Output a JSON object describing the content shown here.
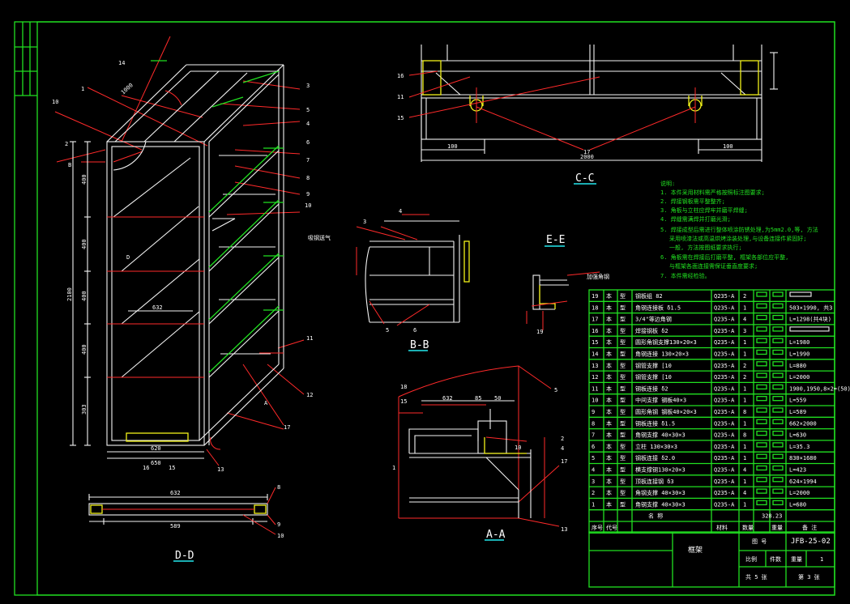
{
  "drawing": {
    "title": "框架",
    "drawing_no": "JFB-25-02",
    "scale": "1",
    "sheet_total": "共 5 张",
    "sheet_no": "第 3 张",
    "title_block_labels": {
      "drawing_no_label": "图 号",
      "scale_label": "比例",
      "qty_label": "件数",
      "weight_label": "重量"
    },
    "bom_footer": {
      "weight_val": "328.23",
      "labels": [
        "序号",
        "代号",
        "名 称",
        "数量",
        "材料",
        "重量",
        "备 注"
      ]
    }
  },
  "views": {
    "cc": "C-C",
    "bb": "B-B",
    "ee": "E-E",
    "aa": "A-A",
    "dd": "D-D"
  },
  "annotations": {
    "airflow": "吸钢送气",
    "gusset": "加强角钢"
  },
  "notes": {
    "heading": "说明:",
    "lines": [
      "1. 本件采用材料需严格按照标注图要求;",
      "2. 焊接钢板需平整整齐;",
      "3. 角板与立柱应焊牢并磨平焊缝;",
      "4. 焊缝需满焊并打磨光滑;",
      "5. 焊接成型后需进行整体喷涂防锈处理,为5mm2.0,等, 方法",
      "采用喷漆法或高温烘烤涂装处理,与设备连接件紧固好;",
      "一般, 方法按图纸要求执行;",
      "6. 角板需在焊接后打磨平整, 框架各部位应平整, ",
      "与框架各面连接需保证垂直度要求;",
      "7. 本件需经检验。"
    ]
  },
  "dimensions": {
    "iso_top_depth": "1000",
    "iso_height": "2100",
    "iso_seg": [
      "400",
      "400",
      "400",
      "400",
      "303"
    ],
    "iso_bottom_w1": "620",
    "iso_bottom_w2": "650",
    "iso_shelf": "632",
    "cc_total": "2000",
    "cc_left": "100",
    "cc_right": "100",
    "dd_top": "632",
    "dd_bottom": "589",
    "aa_top": "632",
    "aa_a": "85",
    "aa_b": "50",
    "aa_c": "10"
  },
  "callouts": {
    "iso": [
      "14",
      "10",
      "1",
      "2",
      "3",
      "5",
      "7",
      "8",
      "9",
      "10",
      "11",
      "12",
      "13",
      "16",
      "15",
      "17",
      "4",
      "6",
      "A",
      "D",
      "B"
    ],
    "cc": [
      "16",
      "11",
      "15",
      "17"
    ],
    "bb": [
      "3",
      "4",
      "5",
      "6",
      "19"
    ],
    "aa": [
      "18",
      "15",
      "2",
      "17",
      "4",
      "1",
      "5",
      "13"
    ],
    "dd": [
      "8",
      "9",
      "10"
    ]
  },
  "bom_rows": [
    {
      "no": "19",
      "code": "本",
      "cat": "型",
      "name": "钢板组 82",
      "mat": "Q235-A",
      "qty": "2",
      "spec": "",
      "note": "",
      "bar": true
    },
    {
      "no": "18",
      "code": "本",
      "cat": "型",
      "name": "角钢连接板 δ1.5",
      "mat": "Q235-A",
      "qty": "1",
      "spec": "",
      "note": "503×1990, 共3",
      "bar": false
    },
    {
      "no": "17",
      "code": "本",
      "cat": "型",
      "name": "3/4\"等边角钢",
      "mat": "Q235-A",
      "qty": "4",
      "spec": "",
      "note": "L=1298(共4块)",
      "bar": false
    },
    {
      "no": "16",
      "code": "本",
      "cat": "型",
      "name": "焊接钢板 δ2",
      "mat": "Q235-A",
      "qty": "3",
      "spec": "",
      "note": "",
      "bar": true
    },
    {
      "no": "15",
      "code": "本",
      "cat": "型",
      "name": "圆形角钢支撑130×20×3",
      "mat": "Q235-A",
      "qty": "1",
      "spec": "",
      "note": "L=1980",
      "bar": false
    },
    {
      "no": "14",
      "code": "本",
      "cat": "型",
      "name": "角钢连接 130×20×3",
      "mat": "Q235-A",
      "qty": "1",
      "spec": "",
      "note": "L=1990",
      "bar": false
    },
    {
      "no": "13",
      "code": "本",
      "cat": "型",
      "name": "钢管支撑 [10",
      "mat": "Q235-A",
      "qty": "2",
      "spec": "",
      "note": "L=880",
      "bar": false
    },
    {
      "no": "12",
      "code": "本",
      "cat": "型",
      "name": "钢管支撑 [10",
      "mat": "Q235-A",
      "qty": "2",
      "spec": "",
      "note": "L=2000",
      "bar": false
    },
    {
      "no": "11",
      "code": "本",
      "cat": "型",
      "name": "钢板连接 δ2",
      "mat": "Q235-A",
      "qty": "1",
      "spec": "",
      "note": "1900,1950,8×2=(50)",
      "bar": false
    },
    {
      "no": "10",
      "code": "本",
      "cat": "型",
      "name": "中间支撑 钢板40×3",
      "mat": "Q235-A",
      "qty": "1",
      "spec": "",
      "note": "L=559",
      "bar": false
    },
    {
      "no": "9",
      "code": "本",
      "cat": "型",
      "name": "圆形角钢 钢板40×20×3",
      "mat": "Q235-A",
      "qty": "8",
      "spec": "",
      "note": "L=589",
      "bar": false
    },
    {
      "no": "8",
      "code": "本",
      "cat": "型",
      "name": "钢板连接 δ1.5",
      "mat": "Q235-A",
      "qty": "1",
      "spec": "",
      "note": "662×2000",
      "bar": false
    },
    {
      "no": "7",
      "code": "本",
      "cat": "型",
      "name": "角钢支撑 40×30×3",
      "mat": "Q235-A",
      "qty": "8",
      "spec": "",
      "note": "L=630",
      "bar": false
    },
    {
      "no": "6",
      "code": "本",
      "cat": "型",
      "name": "立柱 130×30×3",
      "mat": "Q235-A",
      "qty": "1",
      "spec": "",
      "note": "L=35.3",
      "bar": false
    },
    {
      "no": "5",
      "code": "本",
      "cat": "型",
      "name": "钢板连接 δ2.0",
      "mat": "Q235-A",
      "qty": "1",
      "spec": "",
      "note": "830×1680",
      "bar": false
    },
    {
      "no": "4",
      "code": "本",
      "cat": "型",
      "name": "横支撑钢130×20×3",
      "mat": "Q235-A",
      "qty": "4",
      "spec": "",
      "note": "L=423",
      "bar": false
    },
    {
      "no": "3",
      "code": "本",
      "cat": "型",
      "name": "顶板连接钢 δ3",
      "mat": "Q235-A",
      "qty": "1",
      "spec": "",
      "note": "624×1994",
      "bar": false
    },
    {
      "no": "2",
      "code": "本",
      "cat": "型",
      "name": "角钢支撑 40×30×3",
      "mat": "Q235-A",
      "qty": "4",
      "spec": "",
      "note": "L=2000",
      "bar": false
    },
    {
      "no": "1",
      "code": "本",
      "cat": "型",
      "name": "角钢支撑 40×30×3",
      "mat": "Q235-A",
      "qty": "1",
      "spec": "",
      "note": "L=680",
      "bar": false
    }
  ]
}
